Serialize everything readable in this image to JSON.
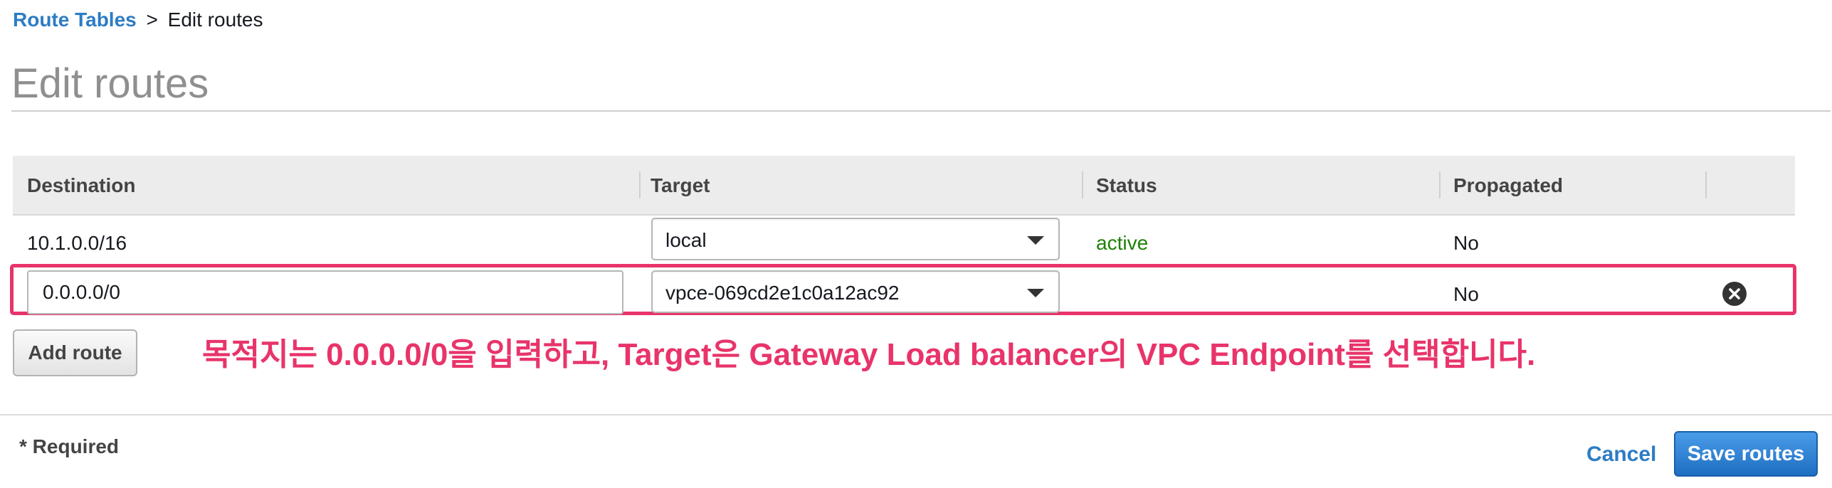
{
  "breadcrumb": {
    "link": "Route Tables",
    "separator": ">",
    "current": "Edit routes"
  },
  "page_title": "Edit routes",
  "table": {
    "headers": [
      "Destination",
      "Target",
      "Status",
      "Propagated"
    ],
    "rows": [
      {
        "destination": "10.1.0.0/16",
        "target": "local",
        "status": "active",
        "propagated": "No"
      },
      {
        "destination": "0.0.0.0/0",
        "target": "vpce-069cd2e1c0a12ac92",
        "status": "",
        "propagated": "No"
      }
    ]
  },
  "add_route_label": "Add route",
  "annotation": "목적지는 0.0.0.0/0을 입력하고, Target은 Gateway Load balancer의 VPC Endpoint를 선택합니다.",
  "required_label": "* Required",
  "cancel_label": "Cancel",
  "save_label": "Save routes",
  "colors": {
    "link": "#2d7cc4",
    "status_active": "#1d8102",
    "highlight": "#e8346a",
    "primary": "#1e6ec2"
  },
  "icons": {
    "remove": "close-circle-icon",
    "dropdown": "chevron-down-icon"
  }
}
